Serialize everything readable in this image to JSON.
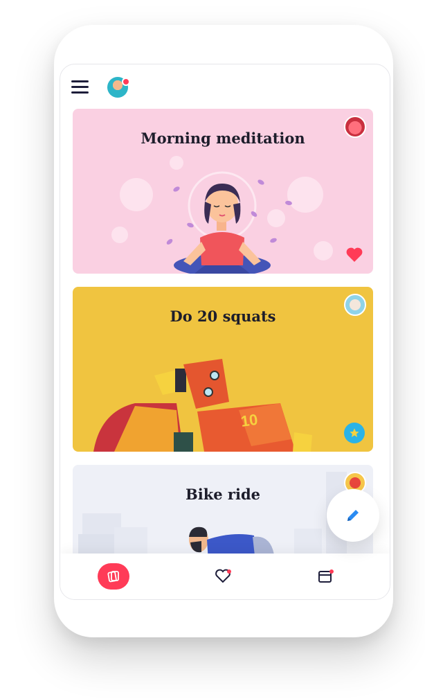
{
  "header": {
    "menu_icon": "hamburger-menu-icon",
    "avatar_icon": "user-avatar"
  },
  "cards": [
    {
      "title": "Morning meditation",
      "bg": "#fad0e2",
      "badge": "face-avatar",
      "action_icon": "heart-icon",
      "action_color": "#ff3b57"
    },
    {
      "title": "Do 20 squats",
      "bg": "#f0c440",
      "badge": "hand-avatar",
      "action_icon": "star-icon",
      "action_color": "#2bb3e6"
    },
    {
      "title": "Bike ride",
      "bg": "#eef0f7",
      "badge": "bird-avatar"
    }
  ],
  "tabbar": {
    "tabs": [
      "cards-tab",
      "favorites-tab",
      "calendar-tab"
    ],
    "accent": "#ff3b57"
  },
  "fab": {
    "icon": "pencil-icon",
    "color": "#2a8bf2"
  }
}
